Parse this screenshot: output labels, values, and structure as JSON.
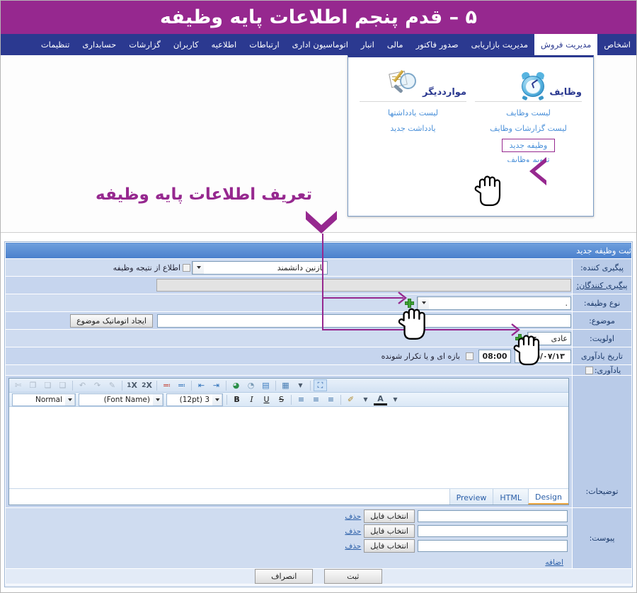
{
  "banner": {
    "title": "۵ – قدم پنجم اطلاعات پایه وظیفه"
  },
  "nav": {
    "items": [
      {
        "label": "اشخاص",
        "active": false
      },
      {
        "label": "مدیریت فروش",
        "active": true
      },
      {
        "label": "مدیریت بازاریابی",
        "active": false
      },
      {
        "label": "صدور فاکتور",
        "active": false
      },
      {
        "label": "مالی",
        "active": false
      },
      {
        "label": "انبار",
        "active": false
      },
      {
        "label": "اتوماسیون اداری",
        "active": false
      },
      {
        "label": "ارتباطات",
        "active": false
      },
      {
        "label": "اطلاعیه",
        "active": false
      },
      {
        "label": "کاربران",
        "active": false
      },
      {
        "label": "گزارشات",
        "active": false
      },
      {
        "label": "حسابداری",
        "active": false
      },
      {
        "label": "تنظیمات",
        "active": false
      }
    ]
  },
  "megamenu": {
    "col_tasks": {
      "title": "وظایف",
      "icon": "alarm-clock-icon",
      "links": [
        "لیست وظایف",
        "لیست گزارشات وظایف"
      ],
      "highlighted_link": "وظیفه جدید",
      "partial_link": "تقویم وظایف"
    },
    "col_other": {
      "title": "مواردديگر",
      "icon": "magnifier-note-icon",
      "links": [
        "لیست یادداشتها",
        "یادداشت جدید"
      ]
    }
  },
  "annotation": {
    "text": "تعریف اطلاعات پایه وظیفه"
  },
  "form": {
    "header": "ثبت وظیفه جدید",
    "rows": {
      "follower_label": "پیگیری کننده:",
      "follower_value": "نازنین دانشمند",
      "follower_checkbox_label": "اطلاع از نتیجه وظیفه",
      "followers_label": "پیگیری کنندگان:",
      "followers_value": "",
      "task_type_label": "نوع وظیفه:",
      "task_type_value": ".",
      "subject_label": "موضوع:",
      "subject_value": "",
      "subject_button": "ایجاد اتوماتیک موضوع",
      "priority_label": "اولویت:",
      "priority_value": "عادی",
      "reminder_date_label": "تاریخ یادآوری",
      "reminder_date_value": "۱۳۹۵/۰۷/۱۳",
      "reminder_time_value": "08:00",
      "recurring_checkbox_label": "بازه ای و یا تکرار شونده",
      "reminder_label": "یادآوری:",
      "description_label": "توضیحات:",
      "attachment_label": "پیوست:"
    }
  },
  "editor": {
    "toolbar_row1": [
      {
        "name": "cut-icon",
        "glyph": "✄",
        "state": "dim"
      },
      {
        "name": "copy-icon",
        "glyph": "❐",
        "state": "dim"
      },
      {
        "name": "paste-icon",
        "glyph": "❏",
        "state": "dim"
      },
      {
        "name": "paste-plain-icon",
        "glyph": "❑",
        "state": "dim"
      },
      {
        "name": "redo-icon",
        "glyph": "↷",
        "state": "dim"
      },
      {
        "name": "undo-icon",
        "glyph": "↶",
        "state": "dim"
      },
      {
        "name": "format-painter-icon",
        "glyph": "✎",
        "state": "dim"
      },
      {
        "name": "superscript-icon",
        "glyph": "X²",
        "state": "normal"
      },
      {
        "name": "subscript-icon",
        "glyph": "X₂",
        "state": "normal"
      },
      {
        "name": "ordered-list-icon",
        "glyph": "☰",
        "state": "normal"
      },
      {
        "name": "unordered-list-icon",
        "glyph": "☷",
        "state": "normal"
      },
      {
        "name": "indent-icon",
        "glyph": "⇥",
        "state": "normal"
      },
      {
        "name": "outdent-icon",
        "glyph": "⇤",
        "state": "normal"
      },
      {
        "name": "link-icon",
        "glyph": "🔗",
        "state": "normal"
      },
      {
        "name": "unlink-icon",
        "glyph": "🔍",
        "state": "normal"
      },
      {
        "name": "image-icon",
        "glyph": "🖼",
        "state": "normal"
      },
      {
        "name": "table-icon",
        "glyph": "▦",
        "state": "normal"
      },
      {
        "name": "table-dropdown-icon",
        "glyph": "▾",
        "state": "normal"
      },
      {
        "name": "fullscreen-icon",
        "glyph": "⛶",
        "state": "on"
      }
    ],
    "toolbar_row2": {
      "style_value": "Normal",
      "font_name_value": "(Font Name)",
      "font_size_value": "3 (12pt)",
      "bold_label": "B",
      "italic_label": "I",
      "underline_label": "U",
      "strike_label": "S",
      "align_right_icon": "align-right-icon",
      "align_center_icon": "align-center-icon",
      "align_left_icon": "align-left-icon",
      "highlight_icon": "highlight-icon",
      "font_color_label": "A"
    },
    "tabs": [
      {
        "label": "Design",
        "selected": true
      },
      {
        "label": "HTML",
        "selected": false
      },
      {
        "label": "Preview",
        "selected": false
      }
    ]
  },
  "attachments": {
    "rows": [
      {
        "value": "",
        "choose_label": "انتخاب فایل",
        "delete_label": "حذف"
      },
      {
        "value": "",
        "choose_label": "انتخاب فایل",
        "delete_label": "حذف"
      },
      {
        "value": "",
        "choose_label": "انتخاب فایل",
        "delete_label": "حذف"
      }
    ],
    "add_label": "اضافه"
  },
  "footer": {
    "submit_label": "ثبت",
    "cancel_label": "انصراف"
  },
  "colors": {
    "banner": "#96288f",
    "navbar": "#2b3990",
    "accent": "#96288f",
    "panel_header": "#5c8fd6",
    "label_bg": "#b9cbe8",
    "link": "#4a90d9"
  }
}
